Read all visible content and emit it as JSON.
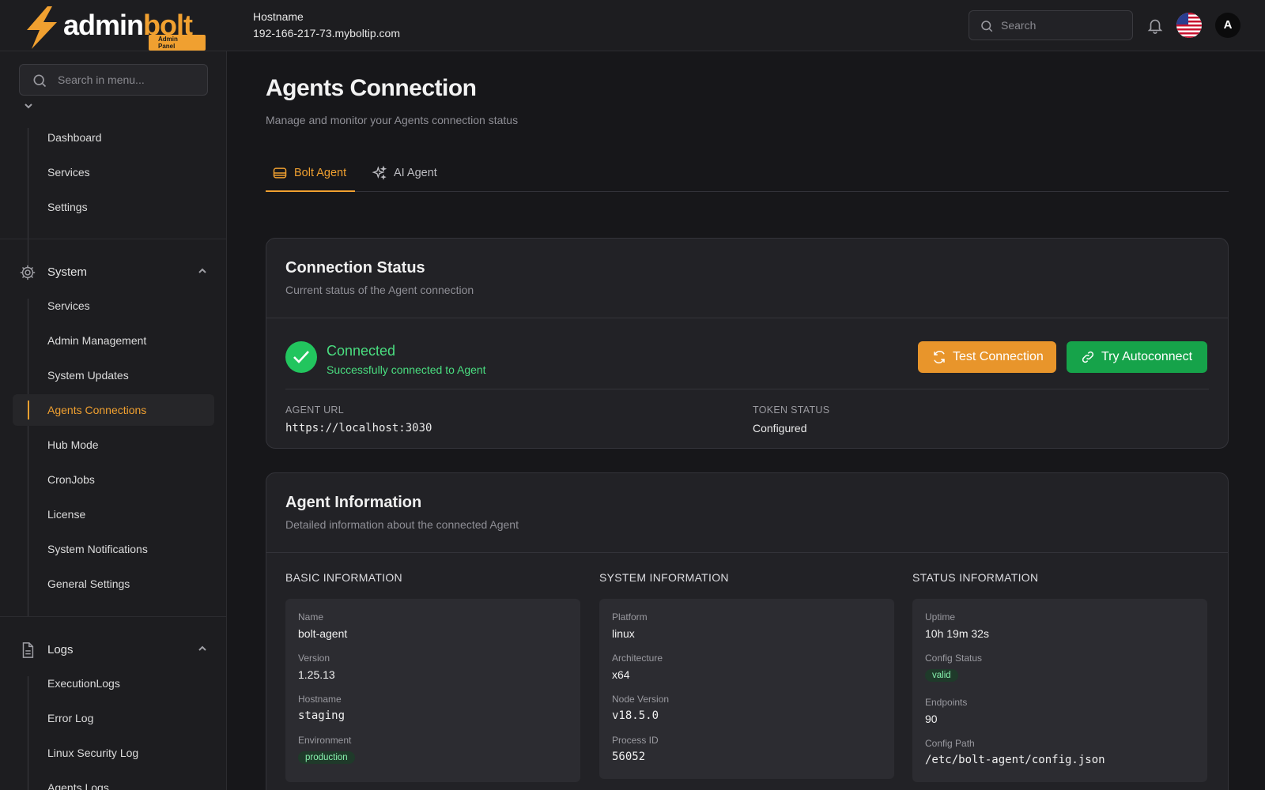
{
  "brand": {
    "name_part1": "admin",
    "name_part2": "bolt",
    "badge": "Admin Panel"
  },
  "header": {
    "hostname_label": "Hostname",
    "hostname_value": "192-166-217-73.myboltip.com",
    "search_placeholder": "Search",
    "avatar_initial": "A"
  },
  "sidebar": {
    "search_placeholder": "Search in menu...",
    "top_group_items": [
      {
        "label": "Dashboard"
      },
      {
        "label": "Services"
      },
      {
        "label": "Settings"
      }
    ],
    "system": {
      "label": "System",
      "items": [
        {
          "label": "Services"
        },
        {
          "label": "Admin Management"
        },
        {
          "label": "System Updates"
        },
        {
          "label": "Agents Connections"
        },
        {
          "label": "Hub Mode"
        },
        {
          "label": "CronJobs"
        },
        {
          "label": "License"
        },
        {
          "label": "System Notifications"
        },
        {
          "label": "General Settings"
        }
      ]
    },
    "logs": {
      "label": "Logs",
      "items": [
        {
          "label": "ExecutionLogs"
        },
        {
          "label": "Error Log"
        },
        {
          "label": "Linux Security Log"
        },
        {
          "label": "Agents Logs"
        }
      ]
    }
  },
  "page": {
    "title": "Agents Connection",
    "subtitle": "Manage and monitor your Agents connection status",
    "tabs": [
      {
        "label": "Bolt Agent",
        "active": true
      },
      {
        "label": "AI Agent",
        "active": false
      }
    ]
  },
  "connection": {
    "title": "Connection Status",
    "subtitle": "Current status of the Agent connection",
    "status": "Connected",
    "status_desc": "Successfully connected to Agent",
    "test_button": "Test Connection",
    "autoconnect_button": "Try Autoconnect",
    "agent_url_label": "AGENT URL",
    "agent_url_value": "https://localhost:3030",
    "token_label": "TOKEN STATUS",
    "token_value": "Configured"
  },
  "agent_info": {
    "title": "Agent Information",
    "subtitle": "Detailed information about the connected Agent",
    "basic": {
      "heading": "BASIC INFORMATION",
      "name_label": "Name",
      "name_value": "bolt-agent",
      "version_label": "Version",
      "version_value": "1.25.13",
      "hostname_label": "Hostname",
      "hostname_value": "staging",
      "environment_label": "Environment",
      "environment_value": "production"
    },
    "system": {
      "heading": "SYSTEM INFORMATION",
      "platform_label": "Platform",
      "platform_value": "linux",
      "arch_label": "Architecture",
      "arch_value": "x64",
      "node_label": "Node Version",
      "node_value": "v18.5.0",
      "pid_label": "Process ID",
      "pid_value": "56052"
    },
    "status": {
      "heading": "STATUS INFORMATION",
      "uptime_label": "Uptime",
      "uptime_value": "10h 19m 32s",
      "config_status_label": "Config Status",
      "config_status_value": "valid",
      "endpoints_label": "Endpoints",
      "endpoints_value": "90",
      "config_path_label": "Config Path",
      "config_path_value": "/etc/bolt-agent/config.json"
    }
  },
  "colors": {
    "accent": "#f0a030",
    "success": "#22c55e",
    "button_orange": "#e8952b",
    "button_green": "#16a34a"
  }
}
